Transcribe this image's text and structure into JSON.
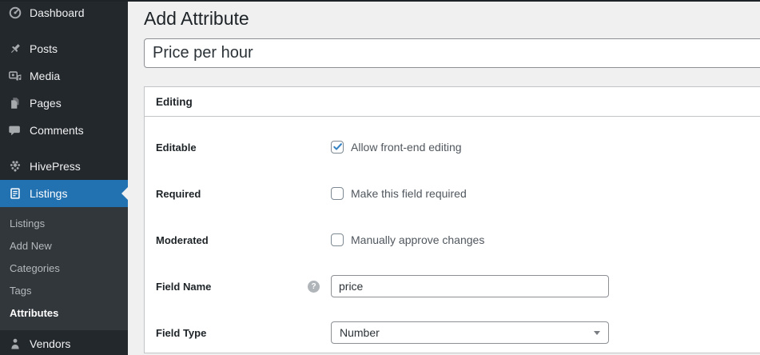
{
  "colors": {
    "sidebar_bg": "#23282d",
    "submenu_bg": "#32373c",
    "active_menu_blue": "#2271b1",
    "content_bg": "#f0f0f1",
    "checkbox_check_blue": "#3582c4",
    "input_border": "#8c8f94",
    "metabox_border": "#c3c4c7"
  },
  "sidebar": {
    "items": [
      {
        "label": "Dashboard",
        "icon": "dashboard-icon"
      },
      {
        "label": "Posts",
        "icon": "pin-icon"
      },
      {
        "label": "Media",
        "icon": "media-icon"
      },
      {
        "label": "Pages",
        "icon": "pages-icon"
      },
      {
        "label": "Comments",
        "icon": "comment-icon"
      },
      {
        "label": "HivePress",
        "icon": "hive-icon"
      },
      {
        "label": "Listings",
        "icon": "document-icon",
        "active": true
      },
      {
        "label": "Vendors",
        "icon": "person-icon"
      }
    ],
    "listings_submenu": [
      {
        "label": "Listings",
        "current": false
      },
      {
        "label": "Add New",
        "current": false
      },
      {
        "label": "Categories",
        "current": false
      },
      {
        "label": "Tags",
        "current": false
      },
      {
        "label": "Attributes",
        "current": true
      }
    ]
  },
  "page": {
    "title": "Add Attribute"
  },
  "title_field": {
    "value": "Price per hour"
  },
  "metabox": {
    "title": "Editing",
    "rows": [
      {
        "label": "Editable",
        "type": "checkbox",
        "checked": true,
        "checkbox_label": "Allow front-end editing"
      },
      {
        "label": "Required",
        "type": "checkbox",
        "checked": false,
        "checkbox_label": "Make this field required"
      },
      {
        "label": "Moderated",
        "type": "checkbox",
        "checked": false,
        "checkbox_label": "Manually approve changes"
      },
      {
        "label": "Field Name",
        "type": "text",
        "value": "price",
        "has_help": true,
        "help_glyph": "?"
      },
      {
        "label": "Field Type",
        "type": "select",
        "value": "Number"
      }
    ]
  }
}
